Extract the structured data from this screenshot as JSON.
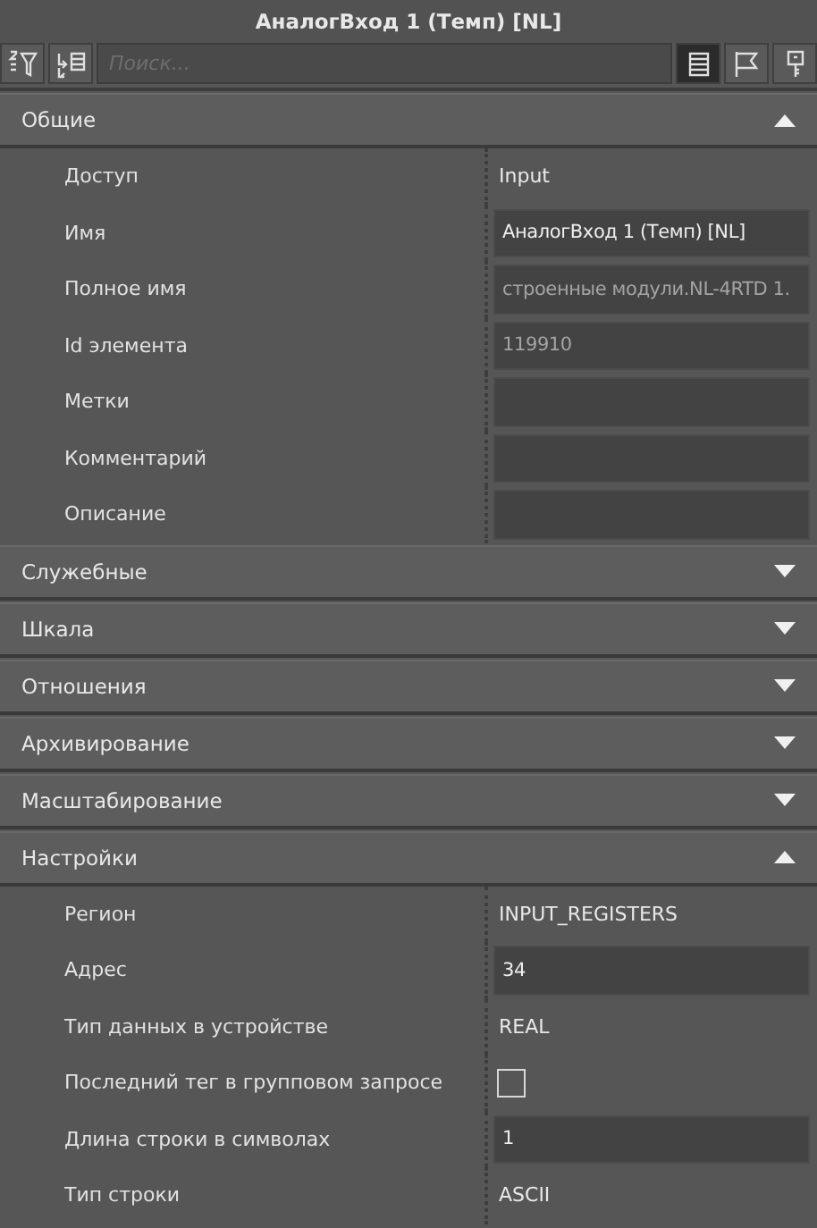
{
  "window": {
    "title": "АналогВход 1 (Темп) [NL]"
  },
  "toolbar": {
    "left_buttons": [
      {
        "kind": "sort-filter"
      },
      {
        "kind": "expand"
      }
    ],
    "search": {
      "placeholder": "Поиск..."
    },
    "view_buttons": [
      {
        "kind": "list",
        "selected": true
      },
      {
        "kind": "flag",
        "selected": false
      },
      {
        "kind": "key",
        "selected": false
      }
    ]
  },
  "sections": [
    {
      "title": "Общие",
      "expanded": true,
      "rows": [
        {
          "label": "Доступ",
          "kind": "text",
          "value": "Input"
        },
        {
          "label": "Имя",
          "kind": "field",
          "value": "АналогВход 1 (Темп) [NL]",
          "disabled": false
        },
        {
          "label": "Полное имя",
          "kind": "field",
          "value": "строенные модули.NL-4RTD 1.",
          "disabled": true
        },
        {
          "label": "Id элемента",
          "kind": "field",
          "value": "119910",
          "disabled": true
        },
        {
          "label": "Метки",
          "kind": "field",
          "disabled": false
        },
        {
          "label": "Комментарий",
          "kind": "field",
          "disabled": false
        },
        {
          "label": "Описание",
          "kind": "field",
          "disabled": false
        }
      ]
    },
    {
      "title": "Служебные",
      "expanded": false
    },
    {
      "title": "Шкала",
      "expanded": false
    },
    {
      "title": "Отношения",
      "expanded": false
    },
    {
      "title": "Архивирование",
      "expanded": false
    },
    {
      "title": "Масштабирование",
      "expanded": false
    },
    {
      "title": "Настройки",
      "expanded": true,
      "rows": [
        {
          "label": "Регион",
          "kind": "text",
          "value": "INPUT_REGISTERS"
        },
        {
          "label": "Адрес",
          "kind": "field",
          "value": "34",
          "disabled": false
        },
        {
          "label": "Тип данных в устройстве",
          "kind": "text",
          "value": "REAL"
        },
        {
          "label": "Последний тег в групповом запросе",
          "kind": "checkbox",
          "checked": false
        },
        {
          "label": "Длина строки в символах",
          "kind": "field",
          "value": "1",
          "disabled": false
        },
        {
          "label": "Тип строки",
          "kind": "text",
          "value": "ASCII"
        }
      ]
    }
  ]
}
